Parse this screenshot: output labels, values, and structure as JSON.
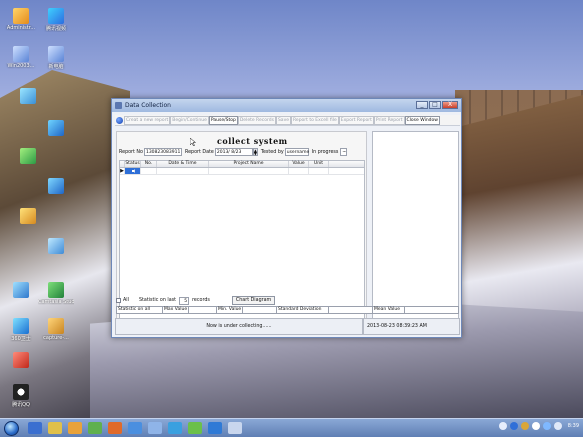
{
  "desktop": {
    "icons": [
      {
        "label": "Administr..."
      },
      {
        "label": "腾讯视频"
      },
      {
        "label": "Win2003..."
      },
      {
        "label": "新电脑"
      },
      {
        "label": "Camtasia Studio"
      },
      {
        "label": "capture-..."
      },
      {
        "label": "360卫士"
      },
      {
        "label": "腾讯QQ"
      }
    ]
  },
  "window": {
    "title": "Data Collection",
    "minimize_symbol": "_",
    "maximize_symbol": "□",
    "close_symbol": "X",
    "toolbar": [
      {
        "label": "Creat a new report",
        "enabled": false
      },
      {
        "label": "Begin/Continue",
        "enabled": false
      },
      {
        "label": "Pause/Stop",
        "enabled": true
      },
      {
        "label": "Delete Records",
        "enabled": false
      },
      {
        "label": "Save",
        "enabled": false
      },
      {
        "label": "Report to Excell file",
        "enabled": false
      },
      {
        "label": "Export Report",
        "enabled": false
      },
      {
        "label": "Print Report",
        "enabled": false
      },
      {
        "label": "Close Window",
        "enabled": true
      }
    ],
    "form": {
      "heading": "collect system",
      "report_no_label": "Report No",
      "report_no_value": "130823083911",
      "report_date_label": "Report Date",
      "report_date_value": "2013/ 8/23",
      "tested_by_label": "Tested by",
      "tested_by_value": "username",
      "status_label": "In progress",
      "status_dropdown": "~"
    },
    "grid": {
      "columns": [
        "",
        "Status",
        "No.",
        "Date & Time",
        "Project Name",
        "Value",
        "Unit"
      ],
      "row_marker": "▶"
    },
    "stats": {
      "all_label": "All",
      "statistic_last_label": "Statistic on last",
      "statistic_last_value": "5",
      "records_label": "records",
      "chart_button": "Chart Diagram",
      "statistic_all_label": "Statistic on all",
      "max_label": "Max  Value",
      "min_label": "Min. Value",
      "std_label": "Standard Deviation",
      "mean_label": "Mean Value"
    },
    "status_bar": {
      "message": "Now is under collecting......",
      "datetime": "2013-08-23 08:39:23 AM"
    }
  },
  "taskbar": {
    "clock": "8:39"
  },
  "colors": {
    "accent": "#2e6fd8",
    "title_bar": "#9fb9e0",
    "taskbar": "#5f7fb4"
  }
}
